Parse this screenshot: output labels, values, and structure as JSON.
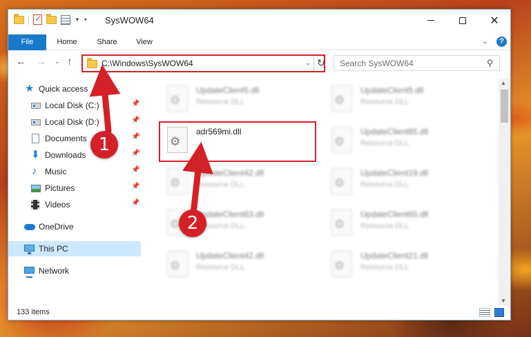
{
  "window": {
    "title": "SysWOW64"
  },
  "ribbon": {
    "tabs": [
      {
        "label": "File"
      },
      {
        "label": "Home"
      },
      {
        "label": "Share"
      },
      {
        "label": "View"
      }
    ]
  },
  "address": {
    "path": "C:\\Windows\\SysWOW64"
  },
  "search": {
    "placeholder": "Search SysWOW64"
  },
  "sidebar": {
    "items": [
      {
        "label": "Quick access"
      },
      {
        "label": "Local Disk (C:)"
      },
      {
        "label": "Local Disk (D:)"
      },
      {
        "label": "Documents"
      },
      {
        "label": "Downloads"
      },
      {
        "label": "Music"
      },
      {
        "label": "Pictures"
      },
      {
        "label": "Videos"
      },
      {
        "label": "OneDrive"
      },
      {
        "label": "This PC"
      },
      {
        "label": "Network"
      }
    ]
  },
  "files": [
    {
      "name": "UpdateClient5.dll",
      "type": "Resource DLL"
    },
    {
      "name": "UpdateClient5.dll",
      "type": "Resource DLL"
    },
    {
      "name": "adr569mi.dll",
      "type": ""
    },
    {
      "name": "UpdateClient65.dll",
      "type": "Resource DLL"
    },
    {
      "name": "UpdateClient42.dll",
      "type": "Resource DLL"
    },
    {
      "name": "UpdateClient19.dll",
      "type": "Resource DLL"
    },
    {
      "name": "UpdateClient63.dll",
      "type": "Resource DLL"
    },
    {
      "name": "UpdateClient65.dll",
      "type": "Resource DLL"
    },
    {
      "name": "UpdateClient42.dll",
      "type": "Resource DLL"
    },
    {
      "name": "UpdateClient21.dll",
      "type": "Resource DLL"
    }
  ],
  "status": {
    "item_count": "133 items"
  },
  "annotations": {
    "step1": "1",
    "step2": "2",
    "color": "#d42027"
  },
  "colors": {
    "file_tab": "#1979ca",
    "selection": "#cce8ff",
    "highlight": "#d42027"
  }
}
